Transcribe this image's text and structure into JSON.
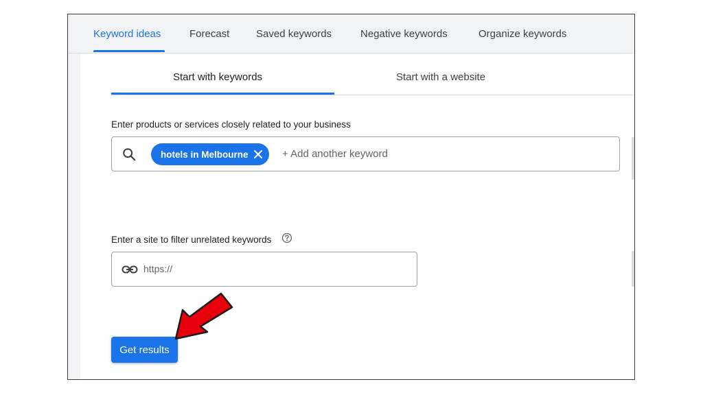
{
  "topnav": {
    "tabs": [
      {
        "label": "Keyword ideas",
        "active": true
      },
      {
        "label": "Forecast"
      },
      {
        "label": "Saved keywords"
      },
      {
        "label": "Negative keywords"
      },
      {
        "label": "Organize keywords"
      }
    ]
  },
  "subtabs": {
    "keywords": "Start with keywords",
    "website": "Start with a website"
  },
  "keywords_section": {
    "label": "Enter products or services closely related to your business",
    "chip": "hotels in Melbourne",
    "placeholder": "+ Add another keyword"
  },
  "site_section": {
    "label": "Enter a site to filter unrelated keywords",
    "placeholder": "https://"
  },
  "button": {
    "label": "Get results"
  },
  "colors": {
    "accent": "#1a73e8",
    "arrow": "#e8000d"
  },
  "icons": [
    "search-icon",
    "close-icon",
    "help-icon",
    "link-icon",
    "pointer-arrow-icon"
  ]
}
